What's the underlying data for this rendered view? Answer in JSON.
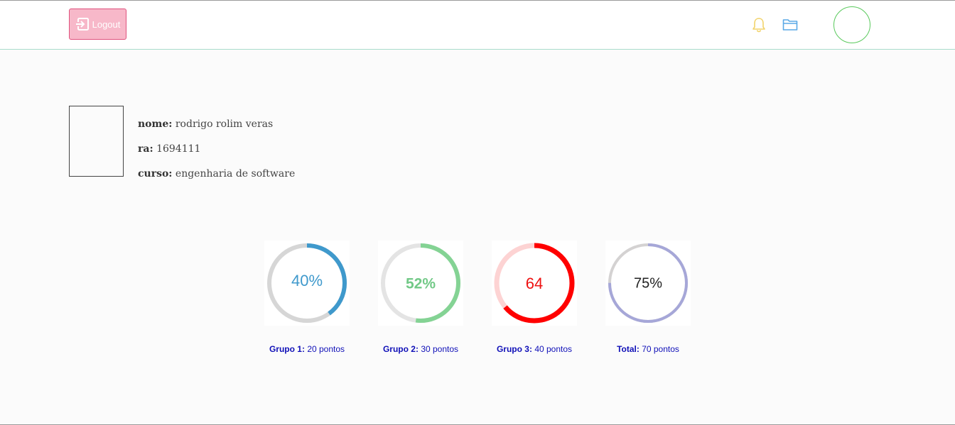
{
  "header": {
    "logout_label": "Logout",
    "icons": {
      "logout": "logout-icon",
      "notifications": "bell-icon",
      "files": "folder-icon"
    },
    "colors": {
      "logout_bg": "#f7b8c9",
      "logout_border": "#e0517d",
      "bell": "#f2d36b",
      "folder": "#5aa9e6",
      "avatar_ring": "#59c95c",
      "navbar_border": "#a9dccb"
    }
  },
  "profile": {
    "name_label": "nome:",
    "name_value": "rodrigo rolim veras",
    "ra_label": "ra:",
    "ra_value": "1694111",
    "course_label": "curso:",
    "course_value": "engenharia de software"
  },
  "gauges": [
    {
      "label": "Grupo 1:",
      "points": "20 pontos",
      "center_text": "40%",
      "fraction": 0.4,
      "color": "#3f99cc",
      "track_color": "#d6d6d6",
      "text_color": "#3f99cc"
    },
    {
      "label": "Grupo 2:",
      "points": "30 pontos",
      "center_text": "52%",
      "fraction": 0.52,
      "color": "#84d394",
      "track_color": "#e4e4e4",
      "text_color": "#72c987"
    },
    {
      "label": "Grupo 3:",
      "points": "40 pontos",
      "center_text": "64",
      "fraction": 0.64,
      "color": "#ff0000",
      "track_color": "#fdd3d3",
      "text_color": "#ee1111"
    },
    {
      "label": "Total:",
      "points": "70 pontos",
      "center_text": "75%",
      "fraction": 0.75,
      "color": "#a6a7d8",
      "track_color": "#d4d2d2",
      "text_color": "#222222"
    }
  ]
}
